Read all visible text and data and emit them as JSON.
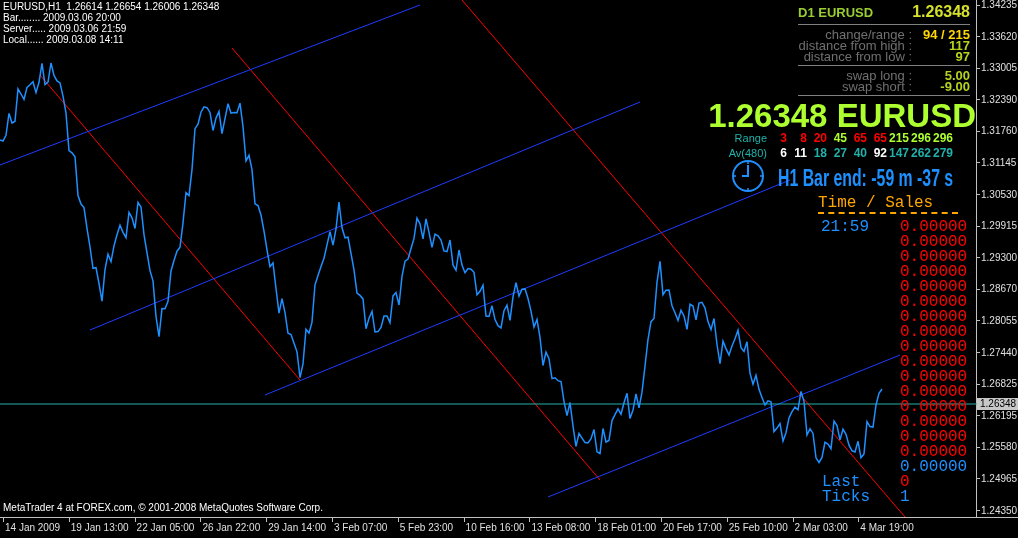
{
  "info": {
    "lines": [
      "EURUSD,H1  1.26614 1.26654 1.26006 1.26348",
      "Bar........ 2009.03.06 20:00",
      "Server..... 2009.03.06 21:59",
      "Local...... 2009.03.08 14:11"
    ]
  },
  "price_axis": {
    "labels": [
      "1.34235",
      "1.33620",
      "1.33005",
      "1.32390",
      "1.31760",
      "1.31145",
      "1.30530",
      "1.29915",
      "1.29300",
      "1.28670",
      "1.28055",
      "1.27440",
      "1.26825",
      "1.26195",
      "1.25580",
      "1.24965",
      "1.24350"
    ]
  },
  "time_axis": {
    "labels": [
      "14 Jan 2009",
      "19 Jan 13:00",
      "22 Jan 05:00",
      "26 Jan 22:00",
      "29 Jan 14:00",
      "3 Feb 07:00",
      "5 Feb 23:00",
      "10 Feb 16:00",
      "13 Feb 08:00",
      "18 Feb 01:00",
      "20 Feb 17:00",
      "25 Feb 10:00",
      "2 Mar 03:00",
      "4 Mar 19:00"
    ]
  },
  "price_marker": "1.26348",
  "footer": "MetaTrader 4 at FOREX.com, © 2001-2008 MetaQuotes Software Corp.",
  "symbol_panel": {
    "title": "D1 EURUSD",
    "price": "1.26348",
    "groups": [
      [
        {
          "label": "change/range :",
          "value": "94 / 215",
          "color": "#ffd700"
        },
        {
          "label": "distance from high :",
          "value": "117",
          "color": "#b4d21e"
        },
        {
          "label": "distance from low :",
          "value": "97",
          "color": "#b4d21e"
        }
      ],
      [
        {
          "label": "swap long :",
          "value": "5.00",
          "color": "#b4d21e"
        },
        {
          "label": "swap short :",
          "value": "-9.00",
          "color": "#b4d21e"
        }
      ]
    ]
  },
  "big_quote": "1.26348 EURUSD",
  "range_table": {
    "rows": [
      {
        "label": "Range",
        "cells": [
          {
            "text": "3",
            "color": "#ff0000"
          },
          {
            "text": "8",
            "color": "#ff0000"
          },
          {
            "text": "20",
            "color": "#ff0000"
          },
          {
            "text": "45",
            "color": "#adff2f"
          },
          {
            "text": "65",
            "color": "#ff0000"
          },
          {
            "text": "65",
            "color": "#ff0000"
          },
          {
            "text": "215",
            "color": "#adff2f"
          },
          {
            "text": "296",
            "color": "#adff2f"
          },
          {
            "text": "296",
            "color": "#adff2f"
          }
        ]
      },
      {
        "label": "Av(480)",
        "cells": [
          {
            "text": "6",
            "color": "#ffffff"
          },
          {
            "text": "11",
            "color": "#ffffff"
          },
          {
            "text": "18",
            "color": "#20b2aa"
          },
          {
            "text": "27",
            "color": "#20b2aa"
          },
          {
            "text": "40",
            "color": "#20b2aa"
          },
          {
            "text": "92",
            "color": "#ffffff"
          },
          {
            "text": "147",
            "color": "#20b2aa"
          },
          {
            "text": "262",
            "color": "#20b2aa"
          },
          {
            "text": "279",
            "color": "#20b2aa"
          }
        ]
      }
    ]
  },
  "bar_timer": "H1 Bar end: -59 m -37 s",
  "time_sales": {
    "title": "Time / Sales",
    "time": "21:59",
    "prices": [
      {
        "text": "0.00000",
        "color": "#ff0000"
      },
      {
        "text": "0.00000",
        "color": "#ff0000"
      },
      {
        "text": "0.00000",
        "color": "#ff0000"
      },
      {
        "text": "0.00000",
        "color": "#ff0000"
      },
      {
        "text": "0.00000",
        "color": "#ff0000"
      },
      {
        "text": "0.00000",
        "color": "#ff0000"
      },
      {
        "text": "0.00000",
        "color": "#ff0000"
      },
      {
        "text": "0.00000",
        "color": "#ff0000"
      },
      {
        "text": "0.00000",
        "color": "#ff0000"
      },
      {
        "text": "0.00000",
        "color": "#ff0000"
      },
      {
        "text": "0.00000",
        "color": "#ff0000"
      },
      {
        "text": "0.00000",
        "color": "#ff0000"
      },
      {
        "text": "0.00000",
        "color": "#ff0000"
      },
      {
        "text": "0.00000",
        "color": "#ff0000"
      },
      {
        "text": "0.00000",
        "color": "#ff0000"
      },
      {
        "text": "0.00000",
        "color": "#ff0000"
      },
      {
        "text": "0.00000",
        "color": "#1e90ff"
      }
    ],
    "summary": [
      {
        "label": "Last",
        "value": "0",
        "color": "#ff0000"
      },
      {
        "label": "Ticks",
        "value": "1",
        "color": "#1e90ff"
      }
    ]
  }
}
